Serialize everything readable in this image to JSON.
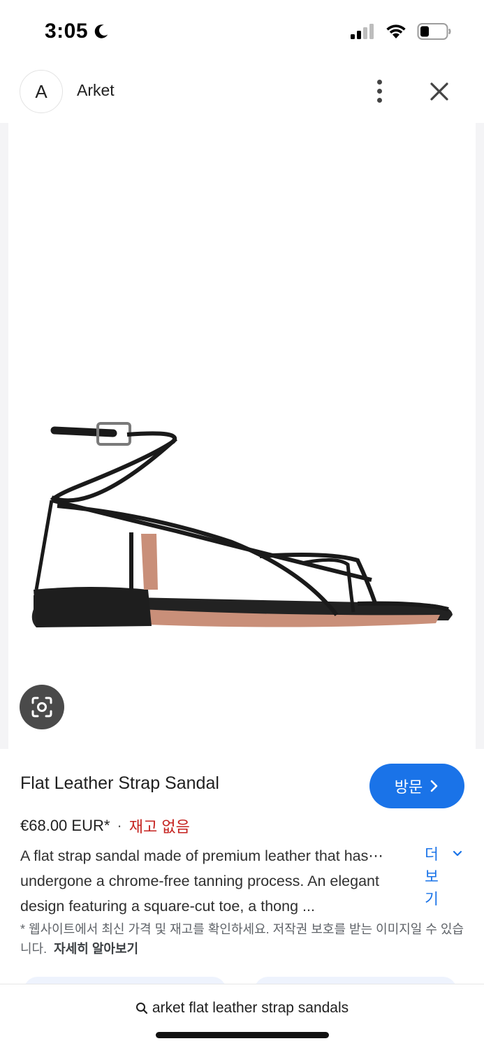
{
  "status_bar": {
    "time": "3:05",
    "icons": [
      "moon-icon",
      "signal-icon",
      "wifi-icon",
      "battery-icon"
    ]
  },
  "header": {
    "avatar_letter": "A",
    "site_name": "Arket",
    "icons": [
      "more-vert-icon",
      "close-icon"
    ]
  },
  "product": {
    "image_description_icon": "lens-icon",
    "title": "Flat Leather Strap Sandal",
    "visit_label": "방문",
    "price": "€68.00 EUR*",
    "separator": "·",
    "stock_status": "재고 없음",
    "description_lines": [
      "A flat strap sandal made of premium leather that has⋯",
      "undergone a chrome-free tanning process. An elegant",
      "design featuring a square-cut toe, a thong ..."
    ],
    "more_label_lines": [
      "더",
      "보",
      "기"
    ],
    "note_text": "* 웹사이트에서 최신 가격 및 재고를 확인하세요. 저작권 보호를 받는 이미지일 수 있습니다.",
    "note_link": "자세히 알아보기"
  },
  "bottom": {
    "search_query": "arket flat leather strap sandals"
  },
  "colors": {
    "accent": "#1a73e8",
    "out_of_stock": "#c5221f",
    "lens_button": "#4a4a4a"
  }
}
